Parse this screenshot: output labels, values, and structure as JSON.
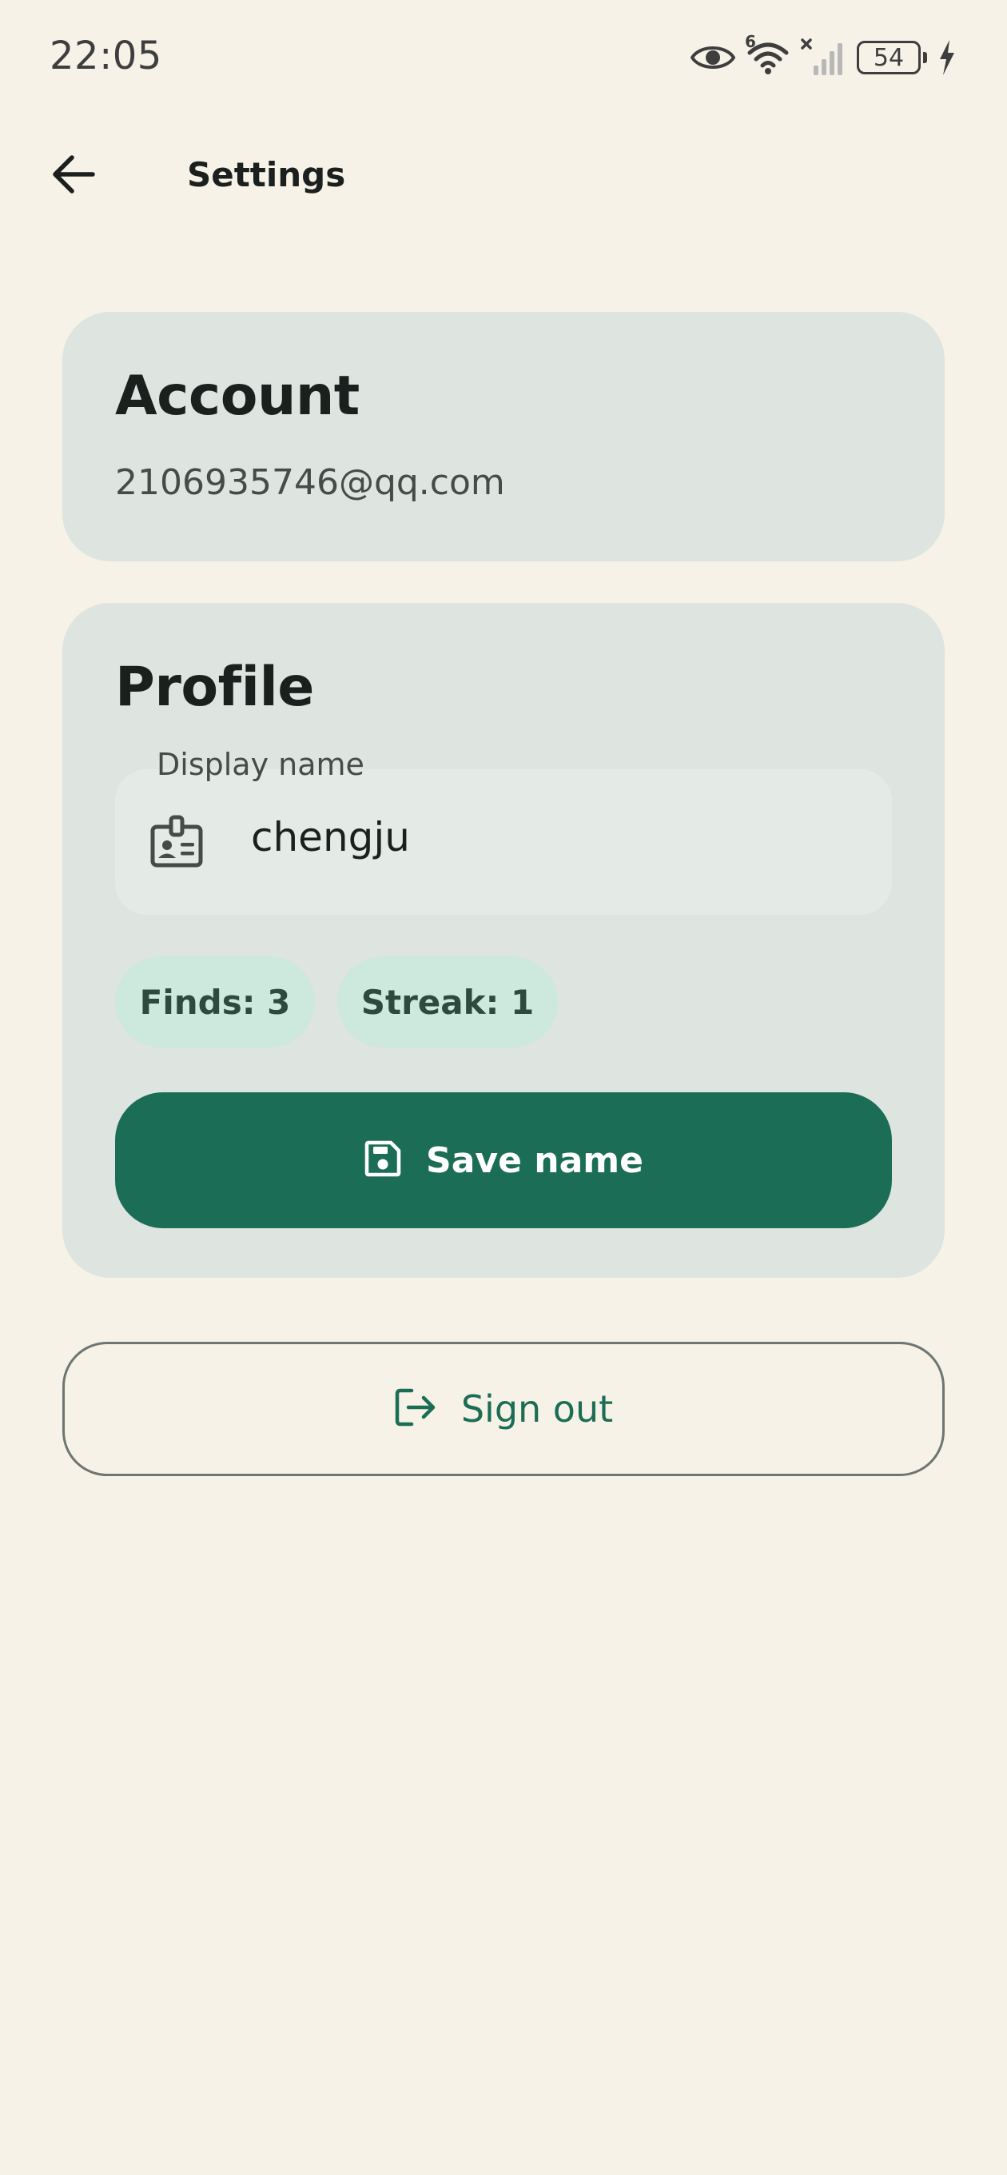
{
  "status_bar": {
    "time": "22:05",
    "battery_level": "54",
    "network_label": "6",
    "icons": [
      "eye-icon",
      "wifi-icon",
      "signal-icon",
      "battery-icon",
      "charging-bolt-icon"
    ]
  },
  "top_bar": {
    "title": "Settings",
    "back_icon": "arrow-left-icon"
  },
  "account": {
    "title": "Account",
    "email": "2106935746@qq.com"
  },
  "profile": {
    "title": "Profile",
    "display_name_label": "Display name",
    "display_name_value": "chengju",
    "field_icon": "badge-icon",
    "finds_chip": "Finds: 3",
    "streak_chip": "Streak: 1",
    "save_label": "Save name",
    "save_icon": "save-icon"
  },
  "sign_out": {
    "label": "Sign out",
    "icon": "logout-icon"
  },
  "colors": {
    "background": "#F6F2E8",
    "card": "#DEE4DF",
    "chip": "#CDE8DC",
    "primary": "#1B6E55",
    "text": "#1B1F1D"
  }
}
